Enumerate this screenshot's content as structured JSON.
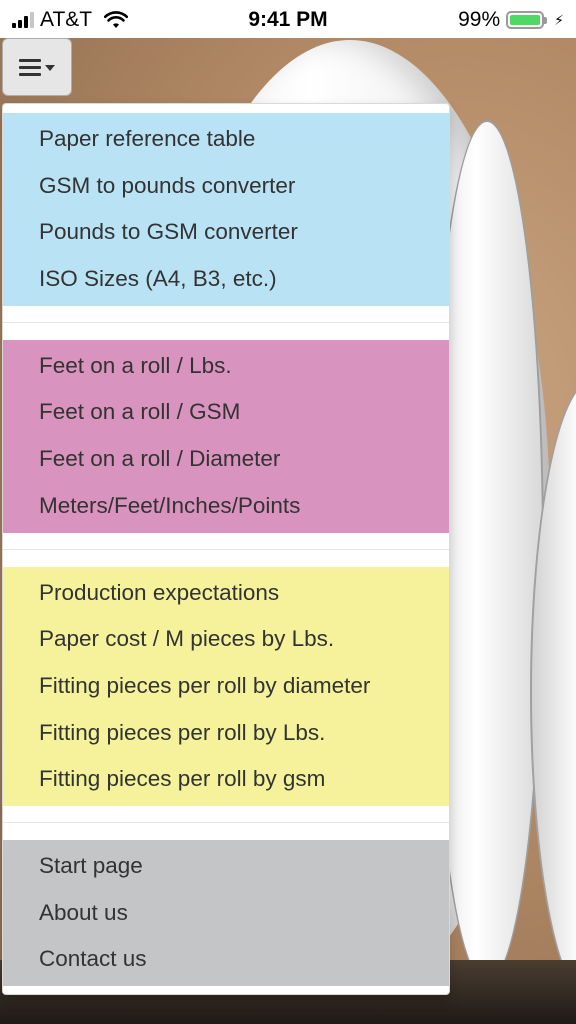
{
  "status_bar": {
    "carrier": "AT&T",
    "time": "9:41 PM",
    "battery_percent": "99%",
    "battery_level": 0.99,
    "battery_color": "#4cd964"
  },
  "menu_button": {
    "icon": "hamburger-menu-icon"
  },
  "menu": {
    "groups": [
      {
        "color": "#b9e3f5",
        "items": [
          "Paper reference table",
          "GSM to pounds converter",
          "Pounds to GSM converter",
          "ISO Sizes (A4, B3, etc.)"
        ]
      },
      {
        "color": "#d993bf",
        "items": [
          "Feet on a roll / Lbs.",
          "Feet on a roll / GSM",
          "Feet on a roll / Diameter",
          "Meters/Feet/Inches/Points"
        ]
      },
      {
        "color": "#f5f29b",
        "items": [
          "Production expectations",
          "Paper cost / M pieces by Lbs.",
          "Fitting pieces per roll by diameter",
          "Fitting pieces per roll by Lbs.",
          "Fitting pieces per roll by gsm"
        ]
      },
      {
        "color": "#c4c5c7",
        "items": [
          "Start page",
          "About us",
          "Contact us"
        ]
      }
    ]
  }
}
